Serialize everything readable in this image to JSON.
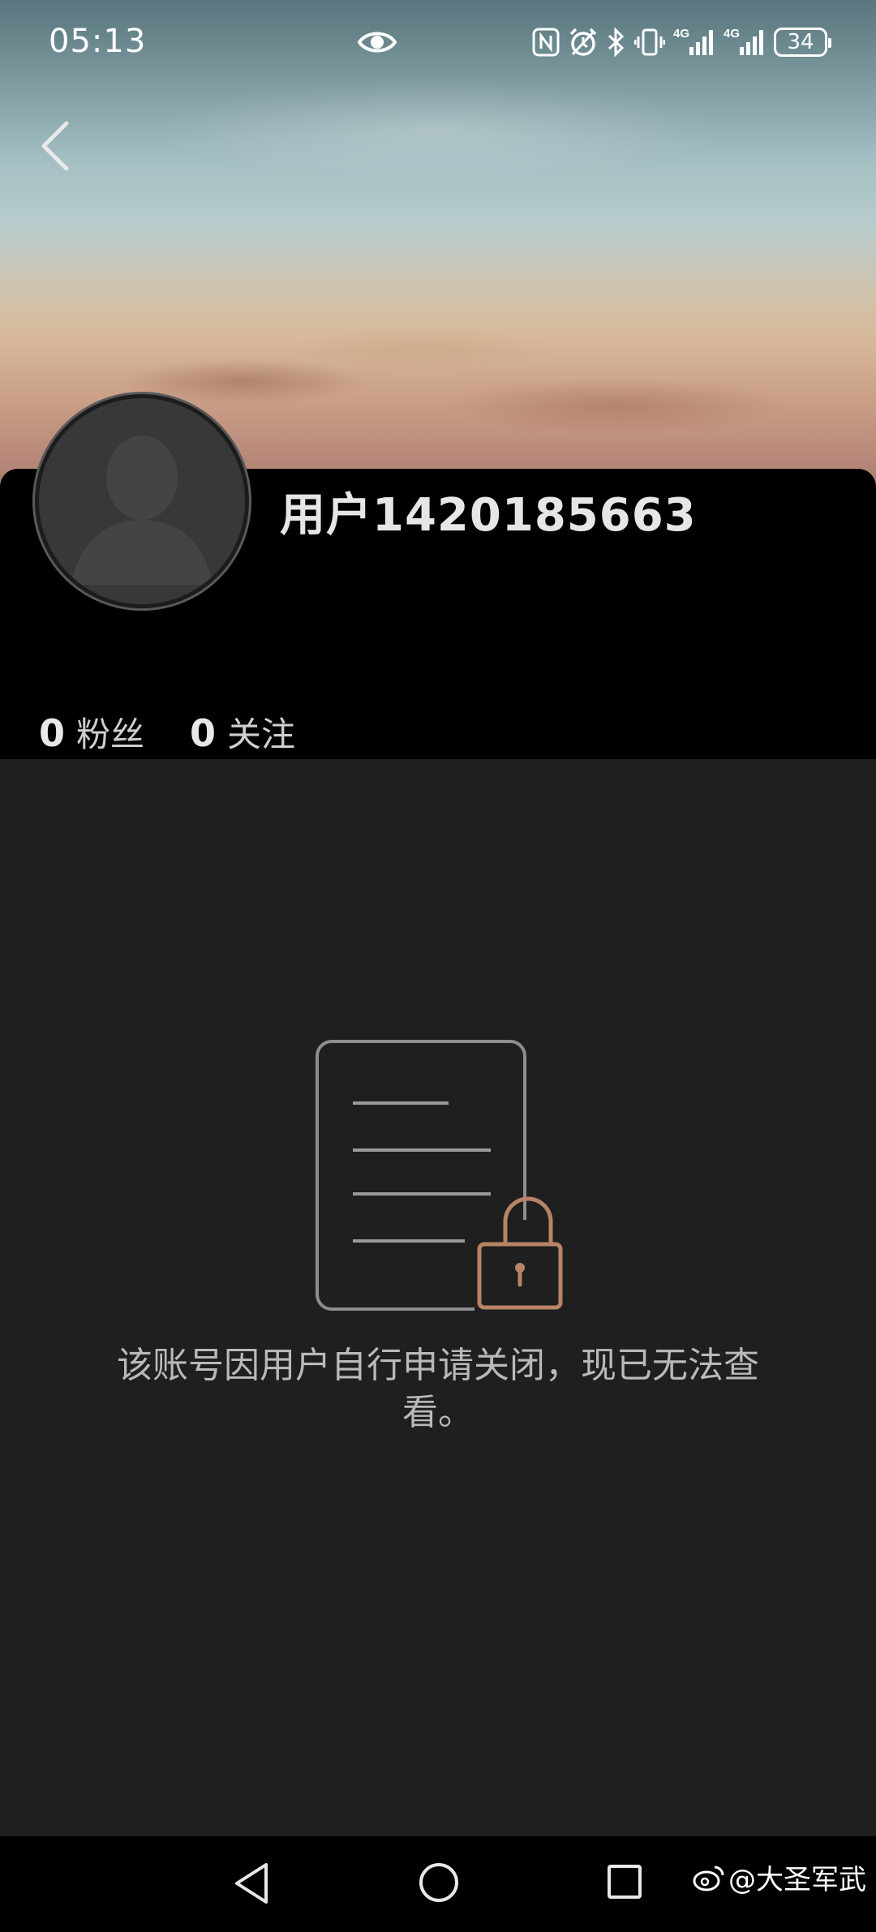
{
  "status_bar": {
    "time": "05:13",
    "battery": "34",
    "icons": [
      "eye-icon",
      "nfc-icon",
      "alarm-icon",
      "bluetooth-icon",
      "vibrate-icon",
      "signal-4g-icon",
      "signal-4g-icon",
      "battery-icon"
    ],
    "network_labels": [
      "4G",
      "4G"
    ]
  },
  "header": {
    "back_icon": "chevron-left-icon"
  },
  "profile": {
    "username": "用户1420185663",
    "followers_count": "0",
    "followers_label": "粉丝",
    "following_count": "0",
    "following_label": "关注",
    "avatar": "default-avatar-icon"
  },
  "main": {
    "illustration_icon": "document-lock-icon",
    "message": "该账号因用户自行申请关闭，现已无法查看。",
    "accent_color": "#b98465"
  },
  "nav_bar": {
    "back_icon": "triangle-back-icon",
    "home_icon": "circle-home-icon",
    "recents_icon": "square-recents-icon"
  },
  "watermark": {
    "text": "@大圣军武",
    "icon": "weibo-icon"
  }
}
